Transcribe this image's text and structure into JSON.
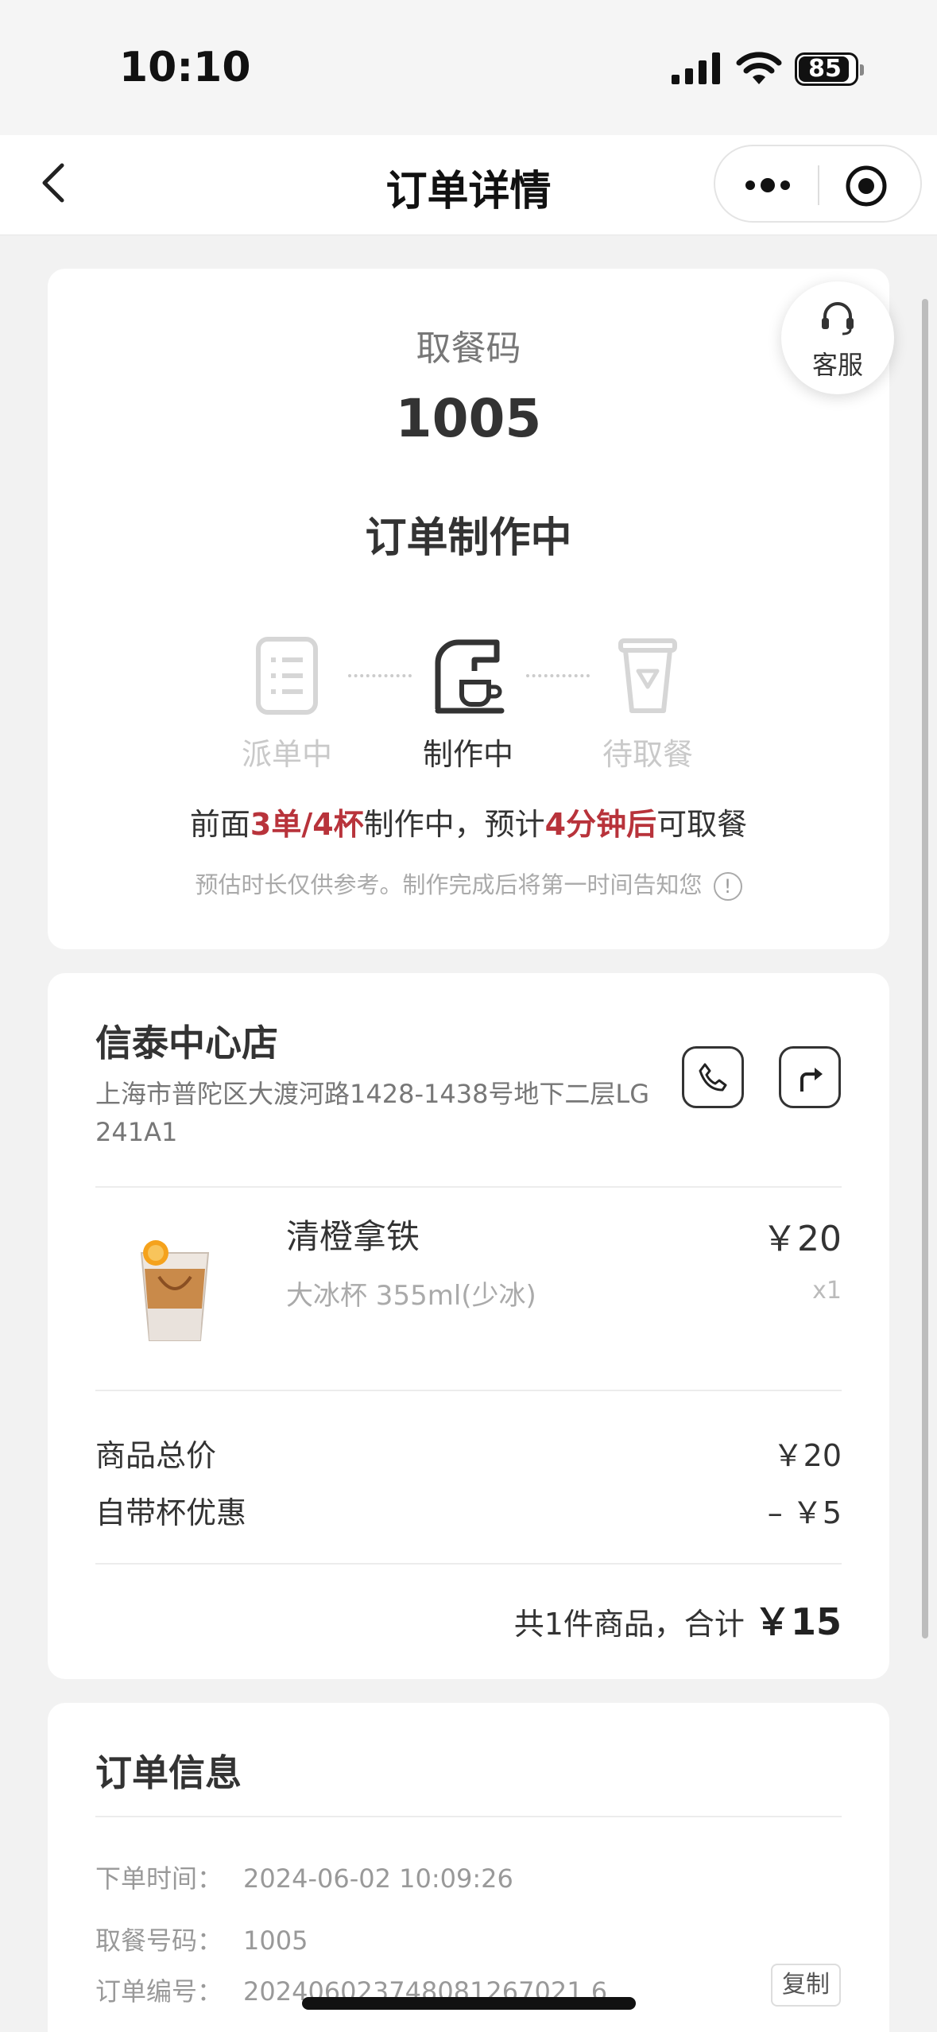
{
  "status_bar": {
    "time": "10:10",
    "battery": "85"
  },
  "nav": {
    "title": "订单详情"
  },
  "pickup": {
    "label": "取餐码",
    "code": "1005",
    "status": "订单制作中",
    "service_label": "客服",
    "steps": [
      {
        "label": "派单中",
        "icon": "clipboard-icon",
        "active": false
      },
      {
        "label": "制作中",
        "icon": "coffee-machine-icon",
        "active": true
      },
      {
        "label": "待取餐",
        "icon": "cup-icon",
        "active": false
      }
    ],
    "queue": {
      "prefix": "前面",
      "count": "3单/4杯",
      "middle": "制作中，预计",
      "eta": "4分钟后",
      "suffix": "可取餐"
    },
    "note": "预估时长仅供参考。制作完成后将第一时间告知您"
  },
  "store": {
    "name": "信泰中心店",
    "address": "上海市普陀区大渡河路1428-1438号地下二层LG 241A1"
  },
  "product": {
    "name": "清橙拿铁",
    "spec": "大冰杯 355ml(少冰)",
    "price": "￥20",
    "qty": "x1"
  },
  "fees": [
    {
      "label": "商品总价",
      "value": "￥20"
    },
    {
      "label": "自带杯优惠",
      "value": "– ￥5"
    }
  ],
  "total": {
    "prefix": "共1件商品，合计 ",
    "amount": "￥15"
  },
  "order_info": {
    "title": "订单信息",
    "rows": [
      {
        "key": "下单时间：",
        "value": "2024-06-02 10:09:26"
      },
      {
        "key": "取餐号码：",
        "value": "1005"
      },
      {
        "key": "订单编号：",
        "value": "202406023748081267021 6"
      }
    ],
    "copy_label": "复制"
  },
  "colors": {
    "accent_red": "#b8333b"
  }
}
